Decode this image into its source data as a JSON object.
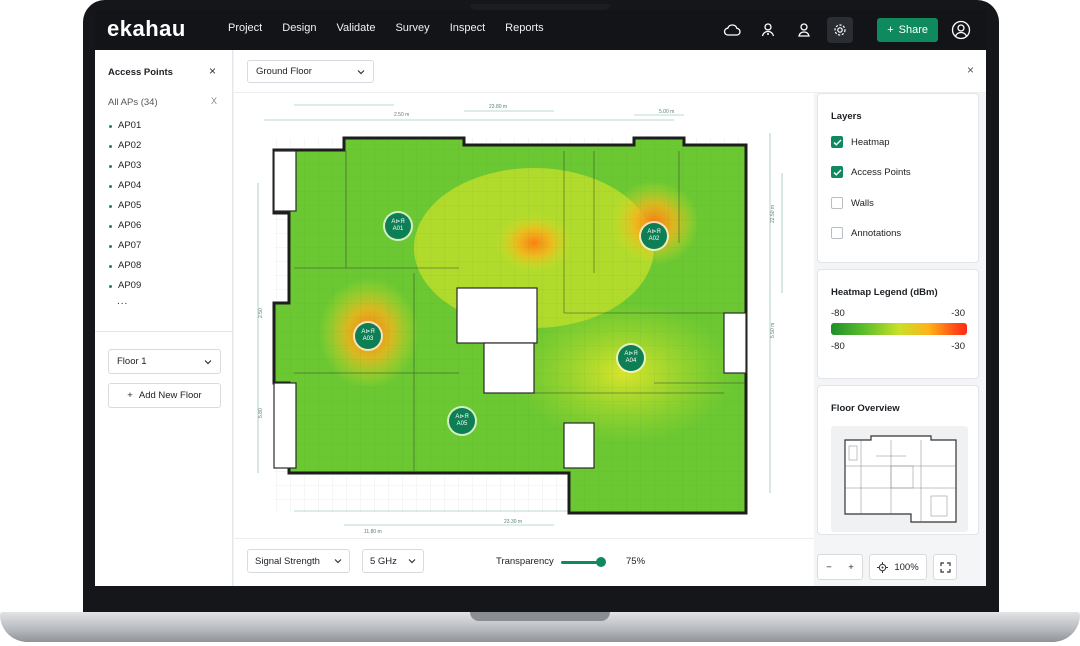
{
  "app": {
    "logo": "ekahau",
    "nav": [
      "Project",
      "Design",
      "Validate",
      "Survey",
      "Inspect",
      "Reports"
    ],
    "share_label": "Share"
  },
  "left_panel": {
    "title": "Access Points",
    "close": "×",
    "all_aps": "All APs (34)",
    "clear": "X",
    "aps": [
      "AP01",
      "AP02",
      "AP03",
      "AP04",
      "AP05",
      "AP06",
      "AP07",
      "AP08",
      "AP09"
    ],
    "more": "...",
    "floor_select": "Floor 1",
    "add_floor": "Add New Floor",
    "add_icon": "+"
  },
  "center": {
    "floor_select": "Ground Floor",
    "close": "×",
    "map_pins": [
      {
        "label_top": "A⊳Я",
        "label_bottom": "A01"
      },
      {
        "label_top": "A⊳Я",
        "label_bottom": "A02"
      },
      {
        "label_top": "A⊳Я",
        "label_bottom": "A03"
      },
      {
        "label_top": "A⊳Я",
        "label_bottom": "A04"
      },
      {
        "label_top": "A⊳Я",
        "label_bottom": "A05"
      }
    ],
    "dimensions": {
      "top_a": "2.50 m",
      "top_b": "23.80 m",
      "top_c": "5.00 m",
      "right_a": "22.50 m",
      "right_b": "5.50 m",
      "left_a": "2.50",
      "left_b": "5.80",
      "bottom_a": "11.80 m",
      "bottom_b": "23.30 m"
    },
    "bottom_bar": {
      "metric": "Signal Strength",
      "band": "5 GHz",
      "transparency_label": "Transparency",
      "transparency_value": "75%"
    }
  },
  "layers": {
    "title": "Layers",
    "items": [
      {
        "label": "Heatmap",
        "checked": true
      },
      {
        "label": "Access Points",
        "checked": true
      },
      {
        "label": "Walls",
        "checked": false
      },
      {
        "label": "Annotations",
        "checked": false
      }
    ]
  },
  "legend": {
    "title": "Heatmap Legend (dBm)",
    "min": "-80",
    "max": "-30",
    "min2": "-80",
    "max2": "-30"
  },
  "overview": {
    "title": "Floor Overview"
  },
  "zoom": {
    "minus": "−",
    "plus": "+",
    "level": "100%"
  },
  "colors": {
    "accent": "#0f8a5f",
    "topbar": "#121417",
    "heat_green": "#5fbf2b",
    "heat_yellow": "#c8e02a",
    "heat_orange": "#ff8a16"
  },
  "transparency_fraction": 0.75
}
